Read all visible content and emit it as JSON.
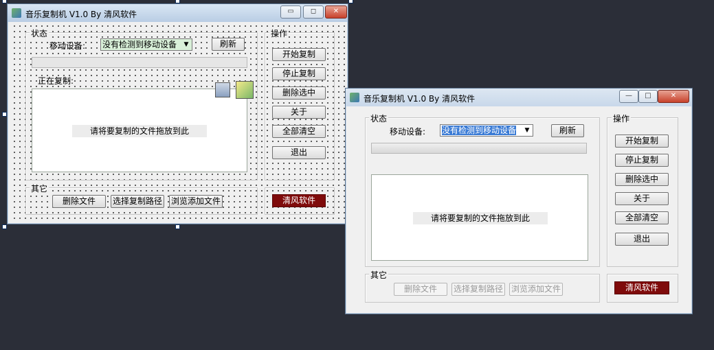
{
  "designer_window": {
    "title": "音乐复制机 V1.0 By 清风软件",
    "controls": {
      "minimize": "▭",
      "maximize": "◻",
      "close": "✕"
    },
    "status_group": "状态",
    "device_label": "移动设备:",
    "device_value": "没有检测到移动设备",
    "refresh": "刷新",
    "copying_label": "正在复制:",
    "drop_hint": "请将要复制的文件拖放到此",
    "ops_group": "操作",
    "buttons": [
      "开始复制",
      "停止复制",
      "删除选中",
      "关于",
      "全部清空",
      "退出"
    ],
    "other_group": "其它",
    "other_buttons": [
      "删除文件",
      "选择复制路径",
      "浏览添加文件"
    ],
    "brand_button": "清风软件"
  },
  "runtime_window": {
    "title": "音乐复制机 V1.0 By 清风软件",
    "controls": {
      "minimize": "—",
      "maximize": "□",
      "close": "✕"
    },
    "status_group": "状态",
    "device_label": "移动设备:",
    "device_value": "没有检测到移动设备",
    "refresh": "刷新",
    "drop_hint": "请将要复制的文件拖放到此",
    "ops_group": "操作",
    "buttons": [
      "开始复制",
      "停止复制",
      "删除选中",
      "关于",
      "全部清空",
      "退出"
    ],
    "other_group": "其它",
    "other_buttons": [
      "删除文件",
      "选择复制路径",
      "浏览添加文件"
    ],
    "brand_button": "清风软件"
  },
  "colors": {
    "background": "#2b2e38",
    "brand": "#7f0b0b",
    "selection": "#3a7bd5"
  }
}
